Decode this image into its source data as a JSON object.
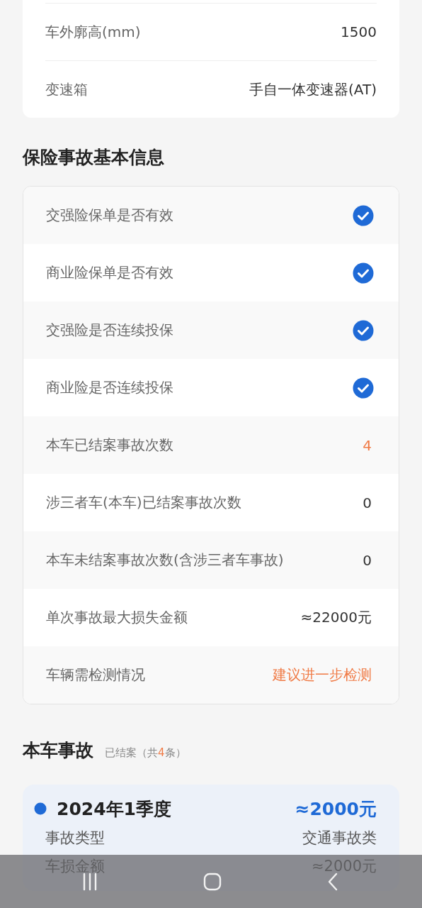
{
  "vehicle_specs": [
    {
      "label": "车外廓高(mm)",
      "value": "1500"
    },
    {
      "label": "变速箱",
      "value": "手自一体变速器(AT)"
    }
  ],
  "insurance_section": {
    "title": "保险事故基本信息",
    "rows": [
      {
        "kind": "check",
        "label": "交强险保单是否有效",
        "checked": true
      },
      {
        "kind": "check",
        "label": "商业险保单是否有效",
        "checked": true
      },
      {
        "kind": "check",
        "label": "交强险是否连续投保",
        "checked": true
      },
      {
        "kind": "check",
        "label": "商业险是否连续投保",
        "checked": true
      },
      {
        "kind": "text",
        "label": "本车已结案事故次数",
        "value": "4",
        "alert": true
      },
      {
        "kind": "text",
        "label": "涉三者车(本车)已结案事故次数",
        "value": "0",
        "alert": false
      },
      {
        "kind": "text",
        "label": "本车未结案事故次数(含涉三者车事故)",
        "value": "0",
        "alert": false
      },
      {
        "kind": "text",
        "label": "单次事故最大损失金额",
        "value": "≈22000元",
        "alert": false
      },
      {
        "kind": "text",
        "label": "车辆需检测情况",
        "value": "建议进一步检测",
        "alert": true
      }
    ]
  },
  "accident_section": {
    "title": "本车事故",
    "subtitle_prefix": "已结案（共",
    "count": "4",
    "subtitle_suffix": "条）",
    "records": [
      {
        "period": "2024年1季度",
        "amount": "≈2000元",
        "details": [
          {
            "label": "事故类型",
            "value": "交通事故类"
          },
          {
            "label": "车损金额",
            "value": "≈2000元"
          }
        ]
      }
    ]
  }
}
